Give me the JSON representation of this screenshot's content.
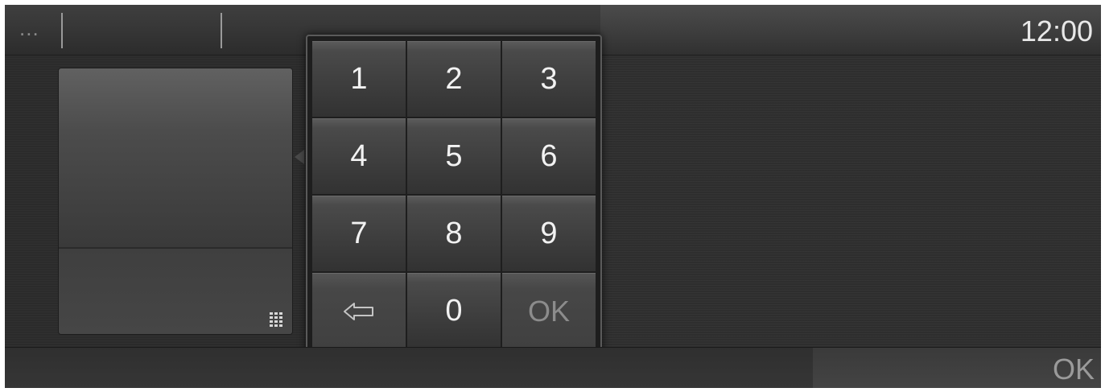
{
  "status_bar": {
    "menu_label": "...",
    "clock": "12:00"
  },
  "keypad": {
    "keys": [
      {
        "label": "1"
      },
      {
        "label": "2"
      },
      {
        "label": "3"
      },
      {
        "label": "4"
      },
      {
        "label": "5"
      },
      {
        "label": "6"
      },
      {
        "label": "7"
      },
      {
        "label": "8"
      },
      {
        "label": "9"
      },
      {
        "label": "",
        "icon": "backspace-arrow-icon"
      },
      {
        "label": "0"
      },
      {
        "label": "OK"
      }
    ]
  },
  "left_panel": {
    "icon": "keypad-grid-icon"
  },
  "bottom_bar": {
    "ok_label": "OK"
  },
  "colors": {
    "background": "#2b2b2b",
    "key_text": "#f2f2f2",
    "dim_text": "#9a9a9a"
  }
}
